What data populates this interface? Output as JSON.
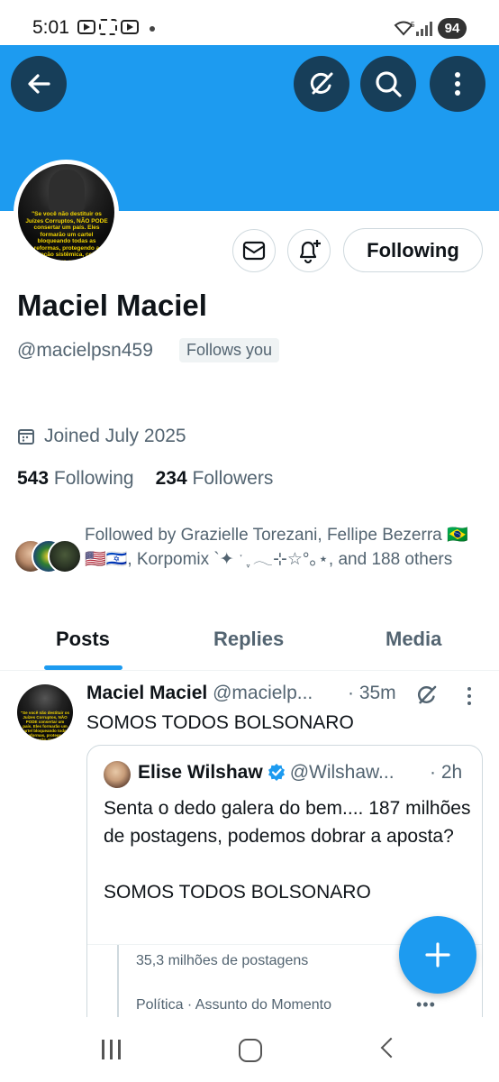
{
  "status_bar": {
    "time": "5:01",
    "network": "5",
    "battery": "94"
  },
  "header": {
    "back_icon": "arrow-left-icon",
    "grok_icon": "grok-icon",
    "search_icon": "search-icon",
    "more_icon": "more-vertical-icon",
    "banner_color": "#1d9bf0"
  },
  "profile": {
    "avatar_caption": "\"Se você não destituir os Juízes Corruptos, NÃO PODE consertar um país. Eles formarão um cartel bloqueando todas as reformas, protegendo a corrupção sistêmica, colocou em seus cargos\"",
    "name": "Maciel Maciel",
    "handle": "@macielpsn459",
    "follows_you": "Follows you",
    "joined": "Joined July 2025",
    "following_count": "543",
    "following_label": "Following",
    "followers_count": "234",
    "followers_label": "Followers",
    "followed_by": "Followed by Grazielle Torezani, Fellipe Bezerra 🇧🇷🇺🇸🇮🇱, Korpomix `✦ ˑ ִֶ 𓂃⊹☆°｡⋆, and 188 others",
    "following_button": "Following",
    "message_icon": "mail-icon",
    "notify_icon": "bell-plus-icon"
  },
  "tabs": [
    {
      "label": "Posts",
      "active": true
    },
    {
      "label": "Replies",
      "active": false
    },
    {
      "label": "Media",
      "active": false
    }
  ],
  "post": {
    "author_name": "Maciel Maciel",
    "author_handle": "@macielp...",
    "time": "· 35m",
    "text": "SOMOS TODOS BOLSONARO",
    "quote": {
      "author_name": "Elise Wilshaw",
      "author_handle": "@Wilshaw...",
      "time": "· 2h",
      "text": "Senta o dedo galera do bem.... 187 milhões de postagens, podemos dobrar a aposta?\n\nSOMOS TODOS BOLSONARO",
      "trend_count": "35,3 milhões de postagens",
      "trend_topic": "Política · Assunto do Momento"
    }
  },
  "fab": {
    "icon": "plus-icon"
  },
  "colors": {
    "accent": "#1d9bf0",
    "text_primary": "#0f1419",
    "text_secondary": "#536471",
    "border": "#cfd9de",
    "header_button": "#173e59"
  }
}
